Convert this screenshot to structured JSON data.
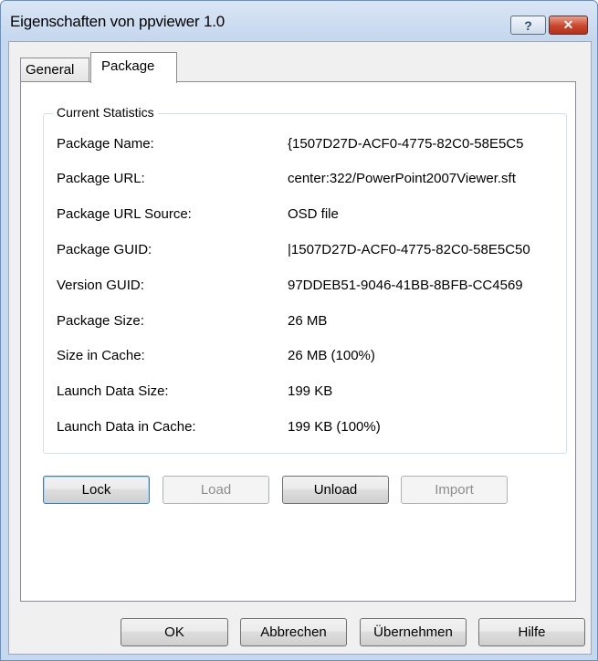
{
  "window": {
    "title": "Eigenschaften von ppviewer 1.0",
    "help_label": "?",
    "close_label": "✕"
  },
  "tabs": [
    {
      "label": "General",
      "active": false
    },
    {
      "label": "Package",
      "active": true
    }
  ],
  "stats": {
    "group_title": "Current Statistics",
    "rows": [
      {
        "label": "Package Name:",
        "value": "{1507D27D-ACF0-4775-82C0-58E5C5"
      },
      {
        "label": "Package URL:",
        "value": "center:322/PowerPoint2007Viewer.sft"
      },
      {
        "label": "Package URL Source:",
        "value": "OSD file"
      },
      {
        "label": "Package GUID:",
        "value": "|1507D27D-ACF0-4775-82C0-58E5C50"
      },
      {
        "label": "Version GUID:",
        "value": "97DDEB51-9046-41BB-8BFB-CC4569"
      },
      {
        "label": "Package Size:",
        "value": "26 MB"
      },
      {
        "label": "Size in Cache:",
        "value": "26 MB (100%)"
      },
      {
        "label": "Launch Data Size:",
        "value": "199 KB"
      },
      {
        "label": "Launch Data in Cache:",
        "value": "199 KB (100%)"
      }
    ]
  },
  "actions": {
    "lock": "Lock",
    "load": "Load",
    "unload": "Unload",
    "import": "Import"
  },
  "footer": {
    "ok": "OK",
    "cancel": "Abbrechen",
    "apply": "Übernehmen",
    "help": "Hilfe"
  }
}
